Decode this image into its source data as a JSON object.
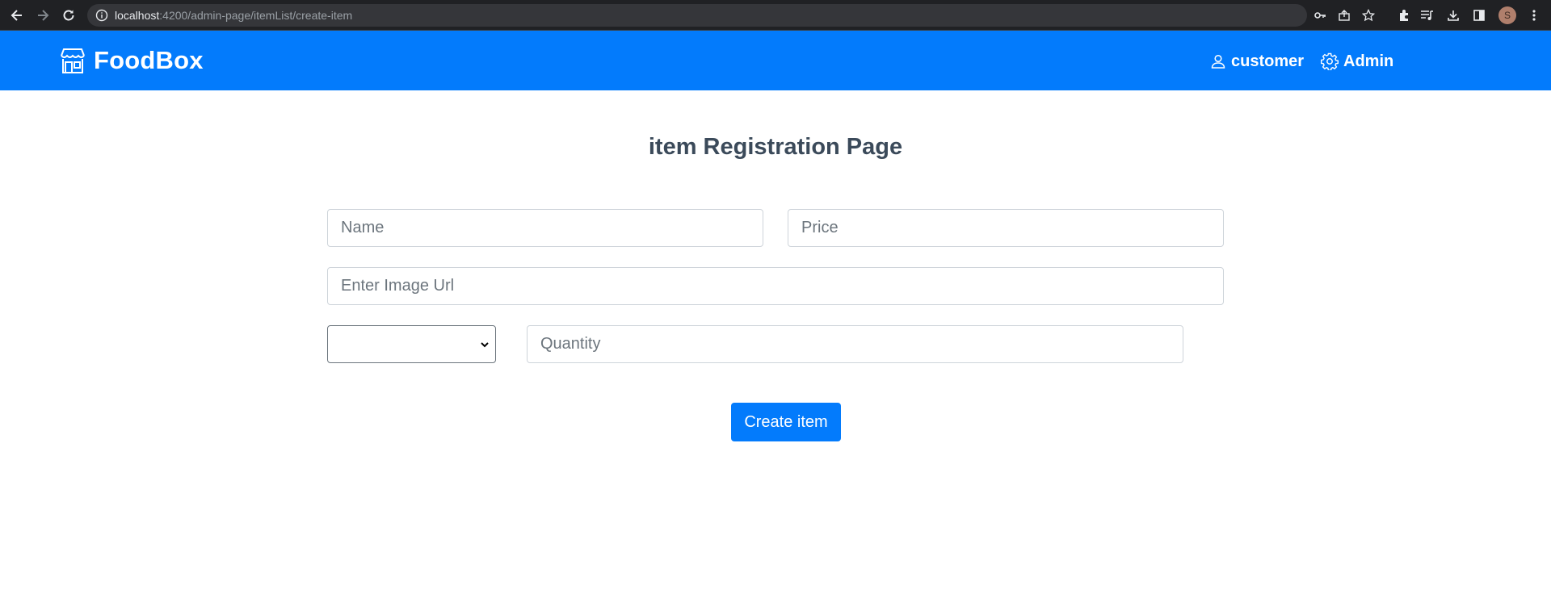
{
  "browser": {
    "url_host": "localhost",
    "url_rest": ":4200/admin-page/itemList/create-item",
    "profile_initial": "S"
  },
  "navbar": {
    "brand": "FoodBox",
    "customer_label": "customer",
    "admin_label": "Admin"
  },
  "page": {
    "title": "item Registration Page"
  },
  "form": {
    "name_placeholder": "Name",
    "price_placeholder": "Price",
    "image_url_placeholder": "Enter Image Url",
    "category_selected": "",
    "quantity_placeholder": "Quantity",
    "submit_label": "Create item"
  },
  "colors": {
    "primary": "#037bfc",
    "title": "#3b4a5a",
    "chrome_bg": "#202124"
  }
}
